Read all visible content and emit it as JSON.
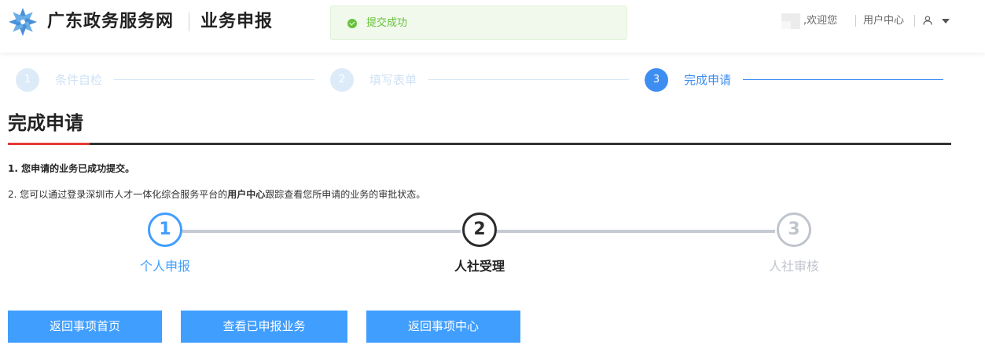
{
  "header": {
    "site_title": "广东政务服务网",
    "page_name": "业务申报",
    "welcome": ",欢迎您",
    "user_center": "用户中心"
  },
  "toast": {
    "text": "提交成功",
    "type": "success"
  },
  "steps": [
    {
      "num": "1",
      "label": "条件自检",
      "state": "done"
    },
    {
      "num": "2",
      "label": "填写表单",
      "state": "done"
    },
    {
      "num": "3",
      "label": "完成申请",
      "state": "active"
    }
  ],
  "section": {
    "title": "完成申请",
    "message1": "1. 您申请的业务已成功提交。",
    "message2_pre": "2. 您可以通过登录深圳市人才一体化综合服务平台的",
    "message2_link": "用户中心",
    "message2_post": "跟踪查看您所申请的业务的审批状态。"
  },
  "progress": [
    {
      "num": "1",
      "label": "个人申报",
      "state": "completed"
    },
    {
      "num": "2",
      "label": "人社受理",
      "state": "current"
    },
    {
      "num": "3",
      "label": "人社审核",
      "state": "pending"
    }
  ],
  "buttons": {
    "back_home": "返回事项首页",
    "view_submitted": "查看已申报业务",
    "back_center": "返回事项中心"
  },
  "colors": {
    "primary": "#409eff",
    "accent_red": "#e53935",
    "success": "#67c23a"
  }
}
